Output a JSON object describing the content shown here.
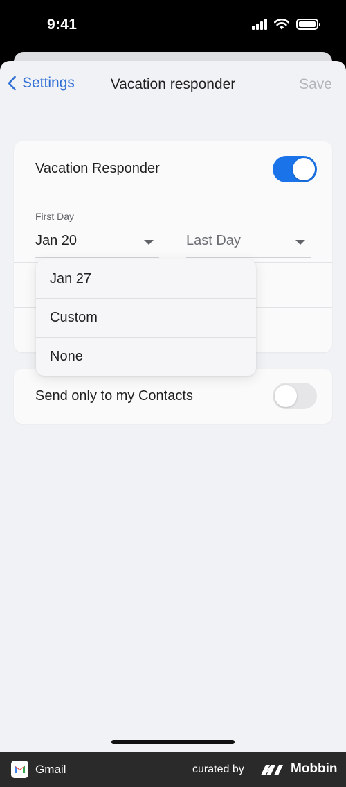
{
  "status_bar": {
    "time": "9:41"
  },
  "nav": {
    "back_label": "Settings",
    "title": "Vacation responder",
    "save_label": "Save"
  },
  "responder": {
    "label": "Vacation Responder",
    "enabled": true,
    "first_day_caption": "First Day",
    "first_day_value": "Jan 20",
    "last_day_placeholder": "Last Day"
  },
  "dropdown": {
    "options": [
      "Jan 27",
      "Custom",
      "None"
    ]
  },
  "contacts": {
    "label": "Send only to my Contacts",
    "enabled": false
  },
  "footer": {
    "app_name": "Gmail",
    "curated_by": "curated by",
    "brand": "Mobbin"
  },
  "colors": {
    "accent": "#1a73e8",
    "link": "#2f6fd6",
    "disabled": "#b3b5ba"
  }
}
